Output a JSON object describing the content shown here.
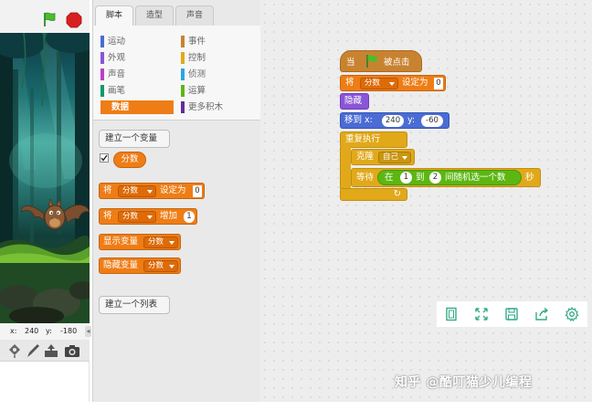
{
  "stage": {
    "coord_x_label": "x:",
    "coord_x_value": "240",
    "coord_y_label": "y:",
    "coord_y_value": "-180",
    "collapse_glyph": "◂",
    "icons": [
      "green-flag-icon",
      "stop-sign-icon",
      "paint-sprite-icon",
      "brush-icon",
      "upload-sprite-icon",
      "camera-icon"
    ]
  },
  "palette": {
    "tabs": [
      {
        "label": "脚本",
        "active": true
      },
      {
        "label": "造型",
        "active": false
      },
      {
        "label": "声音",
        "active": false
      }
    ],
    "categories": [
      {
        "label": "运动",
        "color": "#4a6cd4"
      },
      {
        "label": "外观",
        "color": "#8a55d7"
      },
      {
        "label": "声音",
        "color": "#bb42c3"
      },
      {
        "label": "画笔",
        "color": "#0e9a6c"
      },
      {
        "label": "数据",
        "color": "#ee7d16",
        "active": true
      },
      {
        "label": "事件",
        "color": "#c88330"
      },
      {
        "label": "控制",
        "color": "#e1a91a"
      },
      {
        "label": "侦测",
        "color": "#2ca5e2"
      },
      {
        "label": "运算",
        "color": "#5cb712"
      },
      {
        "label": "更多积木",
        "color": "#632d99"
      }
    ],
    "make_variable_button": "建立一个变量",
    "variable_reporter": "分数",
    "variable_checked": true,
    "blocks": {
      "set_prefix": "将",
      "set_var": "分数",
      "set_suffix": "设定为",
      "set_value": "0",
      "change_prefix": "将",
      "change_var": "分数",
      "change_suffix": "增加",
      "change_value": "1",
      "show_label": "显示变量",
      "show_var": "分数",
      "hide_label": "隐藏变量",
      "hide_var": "分数"
    },
    "make_list_button": "建立一个列表"
  },
  "script": {
    "hat_prefix": "当",
    "hat_suffix": "被点击",
    "set_prefix": "将",
    "set_var": "分数",
    "set_suffix": "设定为",
    "set_value": "0",
    "hide": "隐藏",
    "goto_label": "移到 x:",
    "goto_x": "240",
    "goto_y_label": "y:",
    "goto_y": "-60",
    "forever": "重复执行",
    "clone_label": "克隆",
    "clone_target": "自己",
    "wait_label": "等待",
    "rand_prefix": "在",
    "rand_from": "1",
    "rand_mid": "到",
    "rand_to": "2",
    "rand_suffix": "间随机选一个数",
    "wait_suffix": "秒",
    "loop_arrow": "↻"
  },
  "zoom_controls": [
    "fit-screen-icon",
    "fullscreen-icon",
    "save-icon",
    "share-icon",
    "settings-gear-icon"
  ],
  "watermark": "知乎 @酷叮猫少儿编程",
  "colors": {
    "data": "#ee7d16",
    "looks": "#8a55d7",
    "motion": "#4a6cd4",
    "control": "#e1a91a",
    "events": "#c88330",
    "operators": "#5cb712",
    "zoom_icon": "#33aa88"
  }
}
